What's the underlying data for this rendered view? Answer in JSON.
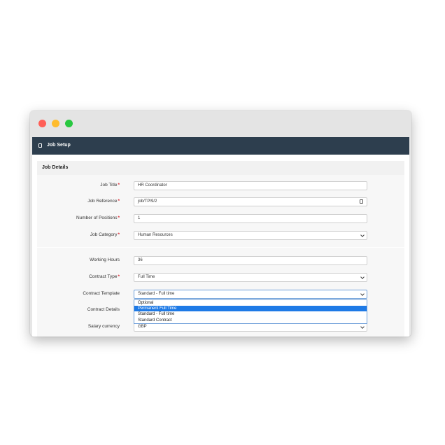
{
  "panel": {
    "title": "Job Setup"
  },
  "section": {
    "title": "Job Details"
  },
  "fields": {
    "job_title": {
      "label": "Job Title",
      "value": "HR Coordinator"
    },
    "job_reference": {
      "label": "Job Reference",
      "value": "job/TP/9/2"
    },
    "num_positions": {
      "label": "Number of Positions",
      "value": "1"
    },
    "job_category": {
      "label": "Job Category",
      "value": "Human Resources"
    },
    "working_hours": {
      "label": "Working Hours",
      "value": "36"
    },
    "contract_type": {
      "label": "Contract Type",
      "value": "Full Time"
    },
    "contract_template": {
      "label": "Contract Template",
      "value": "Standard - Full time"
    },
    "contract_details": {
      "label": "Contract Details"
    },
    "salary_currency": {
      "label": "Salary currency",
      "value": "GBP"
    }
  },
  "contract_template_options": [
    "Optional",
    "Permanent Full Time",
    "Standard - Full time",
    "Standard Contract"
  ],
  "colors": {
    "header_bg": "#2d3e4e",
    "highlight": "#1e7ae6",
    "required": "#d9232e"
  }
}
